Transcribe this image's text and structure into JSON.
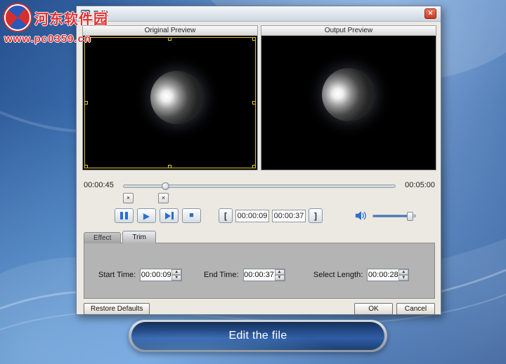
{
  "watermark": {
    "site_name": "河东软件园",
    "site_url": "www.pc0359.cn"
  },
  "icons": {
    "close": "×",
    "marker_x": "×",
    "play": "▶",
    "stop": "■",
    "spinner_up": "▲",
    "spinner_down": "▼"
  },
  "dialog": {
    "title": "Edit",
    "panels": {
      "original_label": "Original Preview",
      "output_label": "Output Preview"
    },
    "timeline": {
      "current": "00:00:45",
      "total": "00:05:00"
    },
    "trim_controls": {
      "open_bracket": "[",
      "close_bracket": "]",
      "start_time": "00:00:09",
      "end_time": "00:00:37"
    },
    "tabs": [
      {
        "label": "Effect",
        "active": false
      },
      {
        "label": "Trim",
        "active": true
      }
    ],
    "trim_panel": {
      "start_time_label": "Start Time:",
      "start_time_value": "00:00:09",
      "end_time_label": "End Time:",
      "end_time_value": "00:00:37",
      "select_length_label": "Select Length:",
      "select_length_value": "00:00:28"
    },
    "footer": {
      "restore_defaults": "Restore Defaults",
      "ok": "OK",
      "cancel": "Cancel"
    }
  },
  "banner": {
    "text": "Edit the file"
  }
}
